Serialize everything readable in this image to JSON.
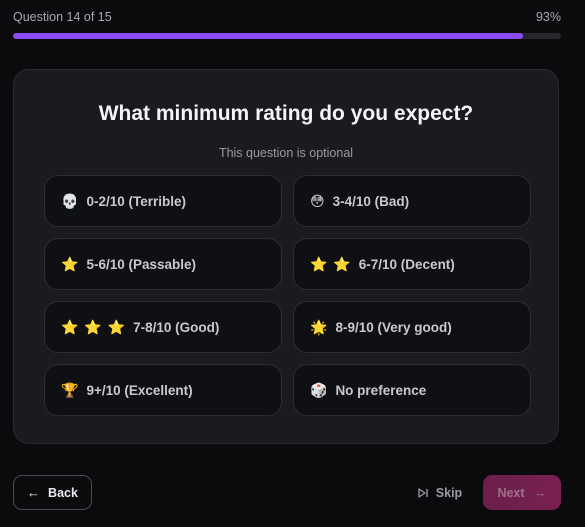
{
  "progress": {
    "label": "Question 14 of 15",
    "percent_text": "93%",
    "fraction": 0.93,
    "fill_color": "#8b4cf6"
  },
  "question": {
    "title": "What minimum rating do you expect?",
    "subtitle": "This question is optional"
  },
  "options": [
    {
      "emoji": "💀",
      "label": "0-2/10 (Terrible)"
    },
    {
      "emoji": "😳",
      "label": "3-4/10 (Bad)"
    },
    {
      "emoji": "⭐",
      "label": "5-6/10 (Passable)"
    },
    {
      "emoji": "⭐ ⭐",
      "label": "6-7/10 (Decent)"
    },
    {
      "emoji": "⭐ ⭐ ⭐",
      "label": "7-8/10 (Good)"
    },
    {
      "emoji": "🌟",
      "label": "8-9/10 (Very good)"
    },
    {
      "emoji": "🏆",
      "label": "9+/10 (Excellent)"
    },
    {
      "emoji": "🎲",
      "label": "No preference"
    }
  ],
  "nav": {
    "back_label": "Back",
    "back_icon": "←",
    "skip_label": "Skip",
    "next_label": "Next",
    "next_icon": "→"
  }
}
